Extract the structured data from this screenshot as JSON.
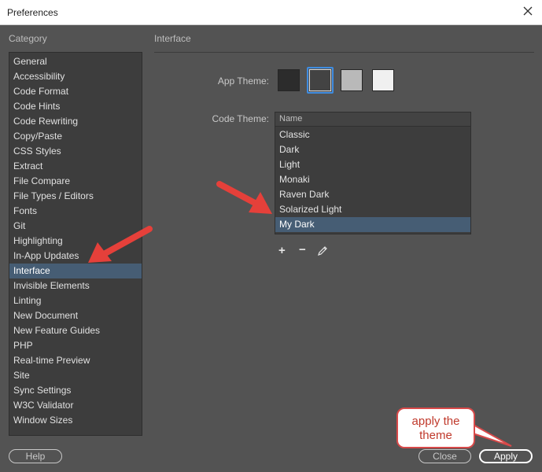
{
  "window": {
    "title": "Preferences"
  },
  "sidebar": {
    "header": "Category",
    "selected_index": 14,
    "items": [
      {
        "label": "General"
      },
      {
        "label": "Accessibility"
      },
      {
        "label": "Code Format"
      },
      {
        "label": "Code Hints"
      },
      {
        "label": "Code Rewriting"
      },
      {
        "label": "Copy/Paste"
      },
      {
        "label": "CSS Styles"
      },
      {
        "label": "Extract"
      },
      {
        "label": "File Compare"
      },
      {
        "label": "File Types / Editors"
      },
      {
        "label": "Fonts"
      },
      {
        "label": "Git"
      },
      {
        "label": "Highlighting"
      },
      {
        "label": "In-App Updates"
      },
      {
        "label": "Interface"
      },
      {
        "label": "Invisible Elements"
      },
      {
        "label": "Linting"
      },
      {
        "label": "New Document"
      },
      {
        "label": "New Feature Guides"
      },
      {
        "label": "PHP"
      },
      {
        "label": "Real-time Preview"
      },
      {
        "label": "Site"
      },
      {
        "label": "Sync Settings"
      },
      {
        "label": "W3C Validator"
      },
      {
        "label": "Window Sizes"
      }
    ]
  },
  "main": {
    "section_title": "Interface",
    "app_theme": {
      "label": "App Theme:",
      "selected_index": 1,
      "swatches": [
        {
          "color": "#2c2c2c"
        },
        {
          "color": "#434343"
        },
        {
          "color": "#b9b9b9"
        },
        {
          "color": "#f0f0f0"
        }
      ]
    },
    "code_theme": {
      "label": "Code Theme:",
      "column_header": "Name",
      "selected_index": 6,
      "items": [
        {
          "label": "Classic"
        },
        {
          "label": "Dark"
        },
        {
          "label": "Light"
        },
        {
          "label": "Monaki"
        },
        {
          "label": "Raven Dark"
        },
        {
          "label": "Solarized Light"
        },
        {
          "label": "My Dark"
        }
      ],
      "tools": {
        "add": "+",
        "remove": "−"
      }
    }
  },
  "footer": {
    "help_label": "Help",
    "close_label": "Close",
    "apply_label": "Apply"
  },
  "annotation": {
    "callout_line1": "apply the",
    "callout_line2": "theme",
    "arrow_color": "#e5403a"
  }
}
